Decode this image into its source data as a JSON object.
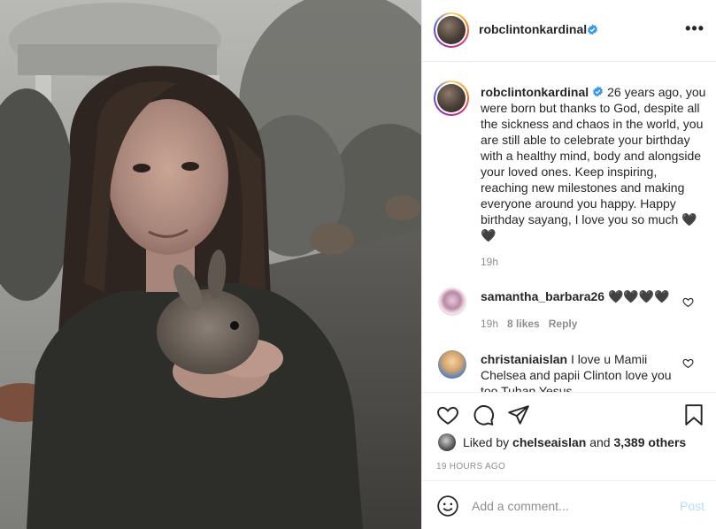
{
  "post": {
    "author": "robclintonkardinal",
    "verified": true,
    "more_icon": "more-horizontal-icon",
    "more_label": "•••"
  },
  "caption": {
    "username": "robclintonkardinal",
    "text": "26 years ago, you were born but thanks to God, despite all the sickness and chaos in the world, you are still able to celebrate your birthday with a healthy mind, body and alongside your loved ones. Keep inspiring, reaching new milestones and making everyone around you happy. Happy birthday sayang, I love you so much 🖤🖤",
    "time": "19h"
  },
  "comments": [
    {
      "username": "samantha_barbara26",
      "text": "🖤🖤🖤🖤",
      "time": "19h",
      "likes": "8 likes",
      "reply": "Reply"
    },
    {
      "username": "christaniaislan",
      "text": "I love u Mamii Chelsea and papii Clinton love you too Tuhan Yesus"
    }
  ],
  "likes": {
    "prefix": "Liked by",
    "user": "chelseaislan",
    "connector": "and",
    "others": "3,389 others"
  },
  "timestamp": "19 HOURS AGO",
  "comment_box": {
    "placeholder": "Add a comment...",
    "post_label": "Post"
  },
  "colors": {
    "verified": "#3897f0",
    "muted": "#8e8e8e",
    "post_disabled": "#b2dffc"
  }
}
